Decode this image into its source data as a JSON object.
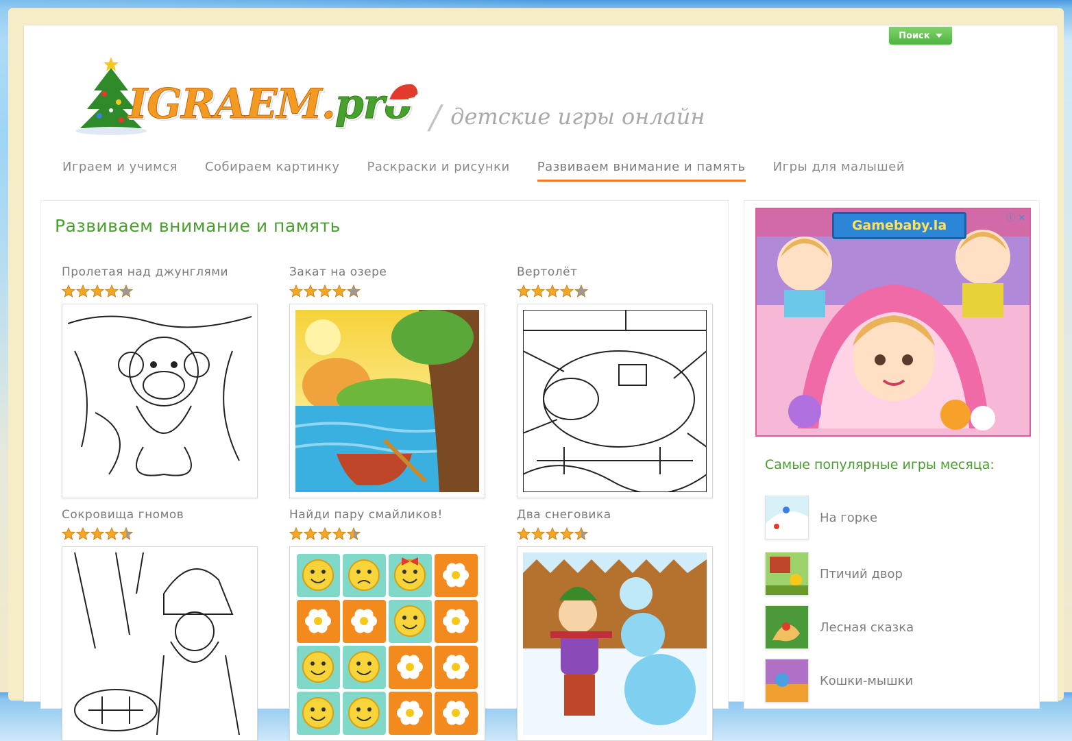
{
  "header": {
    "search_label": "Поиск",
    "logo_main": "IGRAEM.",
    "logo_suffix": "pro",
    "slogan": "детские игры онлайн"
  },
  "nav": {
    "items": [
      {
        "label": "Играем и учимся",
        "active": false
      },
      {
        "label": "Собираем картинку",
        "active": false
      },
      {
        "label": "Раскраски и рисунки",
        "active": false
      },
      {
        "label": "Развиваем внимание и память",
        "active": true
      },
      {
        "label": "Игры для малышей",
        "active": false
      }
    ]
  },
  "main": {
    "title": "Развиваем внимание и память",
    "games": [
      {
        "title": "Пролетая над джунглями",
        "rating": 4,
        "thumb": "monkey-coloring"
      },
      {
        "title": "Закат на озере",
        "rating": 4,
        "thumb": "lake-sunset"
      },
      {
        "title": "Вертолёт",
        "rating": 4,
        "thumb": "helicopter-coloring"
      },
      {
        "title": "Сокровища гномов",
        "rating": 4.5,
        "thumb": "gnome-coloring"
      },
      {
        "title": "Найди пару смайликов!",
        "rating": 4.5,
        "thumb": "smiley-pairs"
      },
      {
        "title": "Два снеговика",
        "rating": 4.5,
        "thumb": "two-snowmen"
      }
    ]
  },
  "sidebar": {
    "ad_brand": "Gamebaby.la",
    "ad_close": "ⓘ ✕",
    "popular_title": "Самые популярные игры месяца:",
    "popular": [
      {
        "label": "На горке"
      },
      {
        "label": "Птичий двор"
      },
      {
        "label": "Лесная сказка"
      },
      {
        "label": "Кошки-мышки"
      }
    ]
  },
  "colors": {
    "accent_green": "#4a9e2f",
    "nav_underline": "#f07a2a",
    "star": "#f5a623"
  }
}
